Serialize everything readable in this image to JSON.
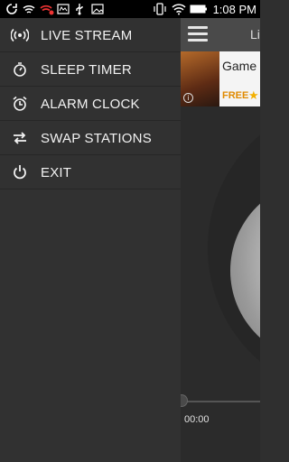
{
  "status_bar": {
    "time": "1:08 PM",
    "icons": [
      "sync-icon",
      "wifi-icon",
      "signal-error-icon",
      "app-icon",
      "usb-icon",
      "picture-icon",
      "vibrate-icon",
      "wifi-signal-icon",
      "battery-icon"
    ]
  },
  "background_app": {
    "header_title": "Li",
    "ad": {
      "title": "Game o",
      "badge": "FREE",
      "rating_icon": "star-icon"
    },
    "player": {
      "elapsed": "00:00"
    }
  },
  "drawer": {
    "items": [
      {
        "label": "LIVE STREAM",
        "icon": "broadcast-icon"
      },
      {
        "label": "SLEEP TIMER",
        "icon": "timer-icon"
      },
      {
        "label": "ALARM CLOCK",
        "icon": "alarm-clock-icon"
      },
      {
        "label": "SWAP STATIONS",
        "icon": "swap-icon"
      },
      {
        "label": "EXIT",
        "icon": "power-icon"
      }
    ]
  },
  "colors": {
    "drawer_bg": "#313131",
    "text": "#f2f2f2",
    "status_bar": "#000000",
    "ad_accent": "#e08a00"
  }
}
